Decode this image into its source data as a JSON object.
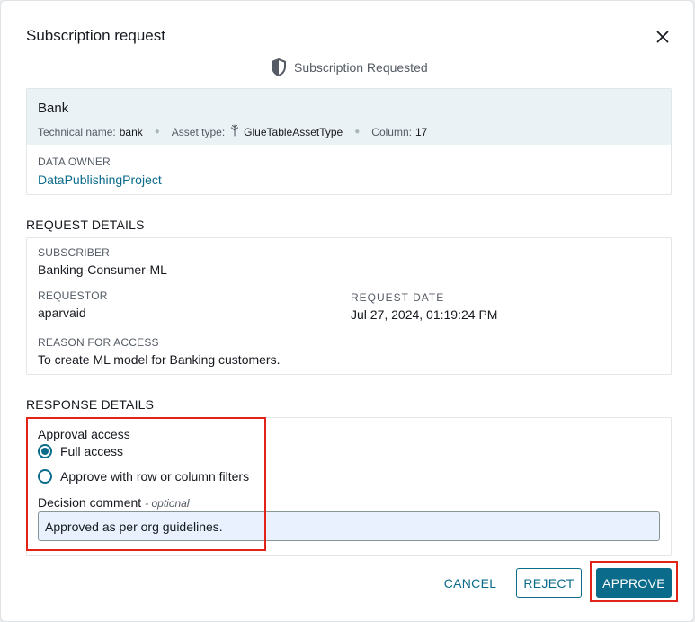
{
  "dialog": {
    "title": "Subscription request",
    "status_text": "Subscription Requested"
  },
  "asset": {
    "name": "Bank",
    "technical_name_label": "Technical name:",
    "technical_name": "bank",
    "asset_type_label": "Asset type:",
    "asset_type": "GlueTableAssetType",
    "column_label": "Column:",
    "column_count": "17",
    "data_owner_label": "DATA OWNER",
    "data_owner": "DataPublishingProject"
  },
  "request_details": {
    "section_title": "REQUEST DETAILS",
    "subscriber_label": "SUBSCRIBER",
    "subscriber": "Banking-Consumer-ML",
    "requestor_label": "REQUESTOR",
    "requestor": "aparvaid",
    "request_date_label": "REQUEST DATE",
    "request_date": "Jul 27, 2024, 01:19:24 PM",
    "reason_label": "REASON FOR ACCESS",
    "reason": "To create ML model for Banking customers."
  },
  "response_details": {
    "section_title": "RESPONSE DETAILS",
    "approval_access_label": "Approval access",
    "options": [
      {
        "label": "Full access",
        "selected": true
      },
      {
        "label": "Approve with row or column filters",
        "selected": false
      }
    ],
    "comment_label": "Decision comment",
    "comment_optional": "- optional",
    "comment_value": "Approved as per org guidelines."
  },
  "actions": {
    "cancel": "CANCEL",
    "reject": "REJECT",
    "approve": "APPROVE"
  },
  "colors": {
    "accent": "#0b6b8b",
    "highlight": "#e2231a",
    "asset_header_bg": "#eaf2f5",
    "input_bg": "#e8f1fd"
  },
  "icons": {
    "close": "close-icon",
    "status": "shield-icon",
    "asset_type": "glue-table-icon"
  }
}
